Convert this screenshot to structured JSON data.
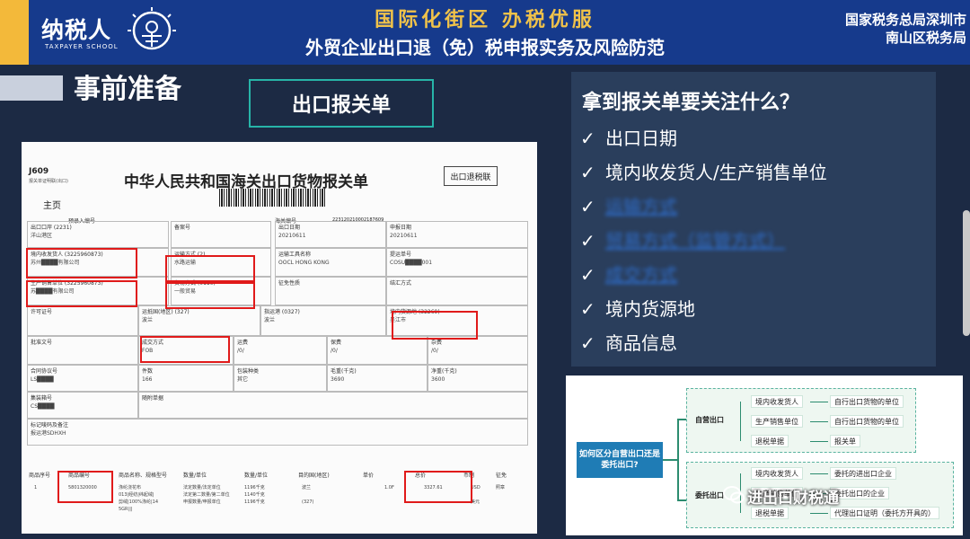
{
  "header": {
    "logo_text": "纳税人",
    "logo_sub": "TAXPAYER SCHOOL",
    "slogan": "国际化街区 办税优服",
    "subtitle": "外贸企业出口退（免）税申报实务及风险防范",
    "org_line1": "国家税务总局深圳市",
    "org_line2": "南山区税务局"
  },
  "section": {
    "title": "事前准备",
    "form_label": "出口报关单"
  },
  "document": {
    "code": "J609",
    "code_sub": "报关单证明联(出口)",
    "title": "中华人民共和国海关出口货物报关单",
    "stamp": "出口退税联",
    "main": "主页",
    "preentry": "预录入编号",
    "customs_no_label": "海关编号",
    "customs_no": "223120210002187609",
    "cells": [
      {
        "lab": "出口口岸 (2231)",
        "val": "洋山港区"
      },
      {
        "lab": "备案号",
        "val": ""
      },
      {
        "lab": "出口日期",
        "val": "20210611"
      },
      {
        "lab": "申报日期",
        "val": "20210611"
      },
      {
        "lab": "境内收发货人 (3225960873)",
        "val": "苏州████有限公司"
      },
      {
        "lab": "运输方式 (2)",
        "val": "水路运输"
      },
      {
        "lab": "运输工具名称",
        "val": "OOCL HONG KONG"
      },
      {
        "lab": "提运单号",
        "val": "COSU████001"
      },
      {
        "lab": "生产销售单位 (3225960873)",
        "val": "苏████有限公司"
      },
      {
        "lab": "贸易方式 (0110)",
        "val": "一般贸易"
      },
      {
        "lab": "征免性质",
        "val": ""
      },
      {
        "lab": "结汇方式",
        "val": ""
      },
      {
        "lab": "许可证号",
        "val": ""
      },
      {
        "lab": "运抵国(地区) (327)",
        "val": "波兰"
      },
      {
        "lab": "指运港 (0327)",
        "val": "波兰"
      },
      {
        "lab": "境内货源地 (32269)",
        "val": "吴江市"
      },
      {
        "lab": "批准文号",
        "val": ""
      },
      {
        "lab": "成交方式",
        "val": "FOB"
      },
      {
        "lab": "运费",
        "val": "/0/"
      },
      {
        "lab": "保费",
        "val": "/0/"
      },
      {
        "lab": "杂费",
        "val": "/0/"
      },
      {
        "lab": "合同协议号",
        "val": "LS████"
      },
      {
        "lab": "件数",
        "val": "166"
      },
      {
        "lab": "包装种类",
        "val": "其它"
      },
      {
        "lab": "毛重(千克)",
        "val": "3690"
      },
      {
        "lab": "净重(千克)",
        "val": "3600"
      },
      {
        "lab": "集装箱号",
        "val": "CS████"
      },
      {
        "lab": "随附单据",
        "val": ""
      },
      {
        "lab": "标记唛码及备注",
        "val": "报运港SDHXH"
      }
    ],
    "goods_head": [
      "商品序号",
      "商品编号",
      "商品名称、规格型号",
      "数量/单位",
      "数量/单位",
      "目的国(地区)",
      "单价",
      "总价",
      "币制",
      "征免"
    ],
    "goods_row": [
      "1",
      "5801320000",
      "涤纶浇花布",
      "法定数量/法定单位",
      "1196千克",
      "波兰",
      "1.0F",
      "3327.61",
      "USD",
      "照章"
    ],
    "goods_row2": [
      "013|经纺|纬起绒|",
      "法定第二数量/第二单位",
      "1140千克"
    ],
    "goods_row3": [
      "剪绒|100%涤纶|14",
      "申报数量/申报单位",
      "1196千克",
      "(327)",
      "美元"
    ],
    "goods_row4": [
      "5GR|||",
      "",
      ""
    ]
  },
  "panel": {
    "title": "拿到报关单要关注什么？",
    "items": [
      {
        "text": "出口日期",
        "blur": false
      },
      {
        "text": "境内收发货人/生产销售单位",
        "blur": false
      },
      {
        "text": "运输方式",
        "blur": true
      },
      {
        "text": "贸易方式（监管方式）",
        "blur": true
      },
      {
        "text": "成交方式",
        "blur": true
      },
      {
        "text": "境内货源地",
        "blur": false
      },
      {
        "text": "商品信息",
        "blur": false
      }
    ]
  },
  "diagram": {
    "question": "如何区分自营出口还是委托出口?",
    "self_label": "自营出口",
    "self_nodes": [
      "境内收发货人",
      "生产销售单位",
      "退税单据"
    ],
    "self_results": [
      "自行出口货物的单位",
      "自行出口货物的单位",
      "报关单"
    ],
    "agent_label": "委托出口",
    "agent_nodes": [
      "境内收发货人",
      "生产销售单位",
      "退税单据"
    ],
    "agent_results": [
      "委托的进出口企业",
      "委托出口的企业",
      "代理出口证明（委托方开具的）"
    ]
  },
  "watermark": "进出口财税通",
  "check_mark": "✓",
  "colors": {
    "header_bg": "#163a8c",
    "accent_gold": "#f3b93a",
    "teal": "#27b4a8",
    "red_box": "#e01a1a",
    "link_blue": "#2f6cc7"
  }
}
